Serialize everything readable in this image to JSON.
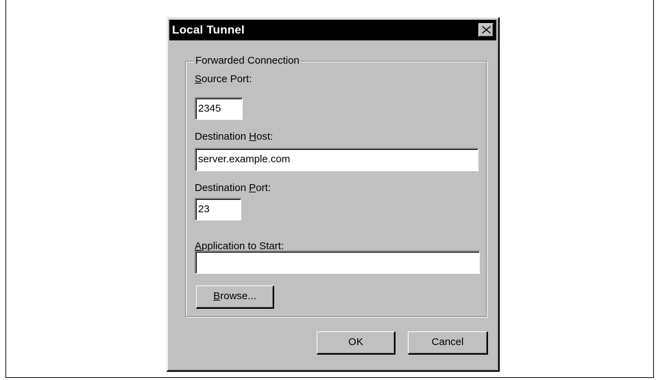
{
  "dialog": {
    "title": "Local Tunnel",
    "close_icon": "close-icon"
  },
  "group": {
    "legend": "Forwarded Connection"
  },
  "fields": {
    "source_port": {
      "label_accel": "S",
      "label_rest": "ource Port:",
      "value": "2345"
    },
    "destination_host": {
      "label_pre": "Destination ",
      "label_accel": "H",
      "label_rest": "ost:",
      "value": "server.example.com"
    },
    "destination_port": {
      "label_pre": "Destination ",
      "label_accel": "P",
      "label_rest": "ort:",
      "value": "23"
    },
    "application": {
      "label_accel": "A",
      "label_rest": "pplication to Start:",
      "value": ""
    }
  },
  "buttons": {
    "browse_accel": "B",
    "browse_rest": "rowse...",
    "ok": "OK",
    "cancel": "Cancel"
  }
}
